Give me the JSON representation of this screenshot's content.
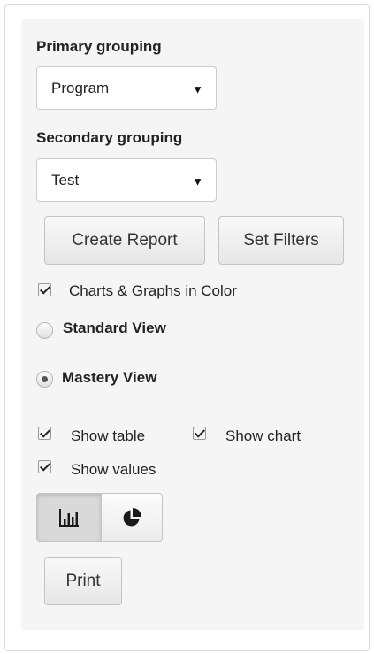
{
  "primary": {
    "heading": "Primary grouping",
    "selected": "Program"
  },
  "secondary": {
    "heading": "Secondary grouping",
    "selected": "Test"
  },
  "buttons": {
    "create_report": "Create Report",
    "set_filters": "Set Filters",
    "print": "Print"
  },
  "options": {
    "color_charts": {
      "label": "Charts & Graphs in Color",
      "checked": true
    },
    "standard_view": {
      "label": "Standard View",
      "selected": false
    },
    "mastery_view": {
      "label": "Mastery View",
      "selected": true
    },
    "show_table": {
      "label": "Show table",
      "checked": true
    },
    "show_chart": {
      "label": "Show chart",
      "checked": true
    },
    "show_values": {
      "label": "Show values",
      "checked": true
    }
  },
  "chart_toggle": {
    "active": "bar-chart-icon",
    "icons": [
      "bar-chart-icon",
      "pie-chart-icon"
    ]
  },
  "colors": {
    "panel_bg": "#f5f5f5",
    "active_segment": "#d9d9d9",
    "icon": "#1a1a1a"
  }
}
